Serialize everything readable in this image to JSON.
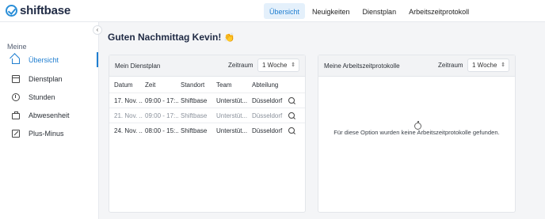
{
  "app": {
    "logo_text": "shiftbase"
  },
  "topnav": {
    "tabs": [
      {
        "label": "Übersicht",
        "active": true
      },
      {
        "label": "Neuigkeiten",
        "active": false
      },
      {
        "label": "Dienstplan",
        "active": false
      },
      {
        "label": "Arbeitszeitprotokoll",
        "active": false
      }
    ]
  },
  "sidebar": {
    "collapse_glyph": "‹",
    "heading": "Meine",
    "items": [
      {
        "label": "Übersicht",
        "icon": "home-icon",
        "active": true
      },
      {
        "label": "Dienstplan",
        "icon": "calendar-icon",
        "active": false
      },
      {
        "label": "Stunden",
        "icon": "stopwatch-icon",
        "active": false
      },
      {
        "label": "Abwesenheit",
        "icon": "suitcase-icon",
        "active": false
      },
      {
        "label": "Plus-Minus",
        "icon": "plus-minus-icon",
        "active": false
      }
    ]
  },
  "main": {
    "greeting": "Guten Nachmittag Kevin!",
    "greeting_emoji": "👏",
    "schedule_card": {
      "title": "Mein Dienstplan",
      "period_label": "Zeitraum",
      "period_value": "1 Woche",
      "columns": [
        "Datum",
        "Zeit",
        "Standort",
        "Team",
        "Abteilung"
      ],
      "rows": [
        {
          "cells": [
            "17. Nov. ...",
            "09:00 - 17:...",
            "Shiftbase",
            "Unterstüt...",
            "Düsseldorf"
          ],
          "muted": false
        },
        {
          "cells": [
            "21. Nov. ...",
            "09:00 - 17:...",
            "Shiftbase",
            "Unterstüt...",
            "Düsseldorf"
          ],
          "muted": true
        },
        {
          "cells": [
            "24. Nov. ...",
            "08:00 - 15:...",
            "Shiftbase",
            "Unterstüt...",
            "Düsseldorf"
          ],
          "muted": false
        }
      ]
    },
    "timesheet_card": {
      "title": "Meine Arbeitszeitprotokolle",
      "period_label": "Zeitraum",
      "period_value": "1 Woche",
      "empty_message": "Für diese Option wurden keine Arbeitszeitprotokolle gefunden."
    }
  },
  "colors": {
    "accent": "#1f7ed0",
    "active_tab_bg": "#e4f0fb",
    "page_bg": "#f4f5f7"
  }
}
